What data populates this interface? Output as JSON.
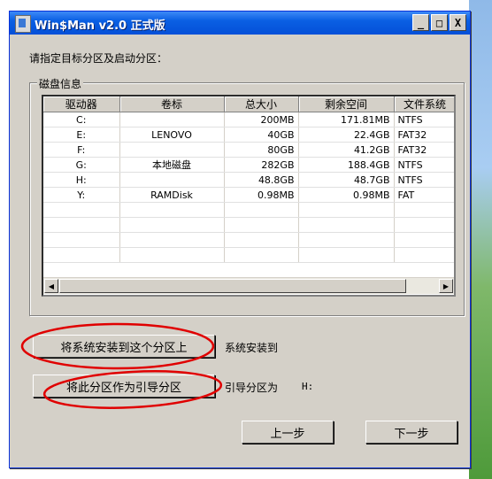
{
  "window": {
    "title": "Win$Man v2.0 正式版"
  },
  "titlebar_buttons": {
    "minimize": "_",
    "maximize": "□",
    "close": "X"
  },
  "prompt": "请指定目标分区及启动分区：",
  "disk_group": {
    "label": "磁盘信息",
    "columns": [
      "驱动器",
      "卷标",
      "总大小",
      "剩余空间",
      "文件系统"
    ],
    "rows": [
      [
        "C:",
        "",
        "200MB",
        "171.81MB",
        "NTFS"
      ],
      [
        "E:",
        "LENOVO",
        "40GB",
        "22.4GB",
        "FAT32"
      ],
      [
        "F:",
        "",
        "80GB",
        "41.2GB",
        "FAT32"
      ],
      [
        "G:",
        "本地磁盘",
        "282GB",
        "188.4GB",
        "NTFS"
      ],
      [
        "H:",
        "",
        "48.8GB",
        "48.7GB",
        "NTFS"
      ],
      [
        "Y:",
        "RAMDisk",
        "0.98MB",
        "0.98MB",
        "FAT"
      ]
    ]
  },
  "actions": {
    "install_button": "将系统安装到这个分区上",
    "install_status": "系统安装到",
    "boot_button": "将此分区作为引导分区",
    "boot_status": "引导分区为",
    "boot_value": "H:"
  },
  "nav": {
    "prev": "上一步",
    "next": "下一步"
  },
  "annotation_color": "#e00000"
}
